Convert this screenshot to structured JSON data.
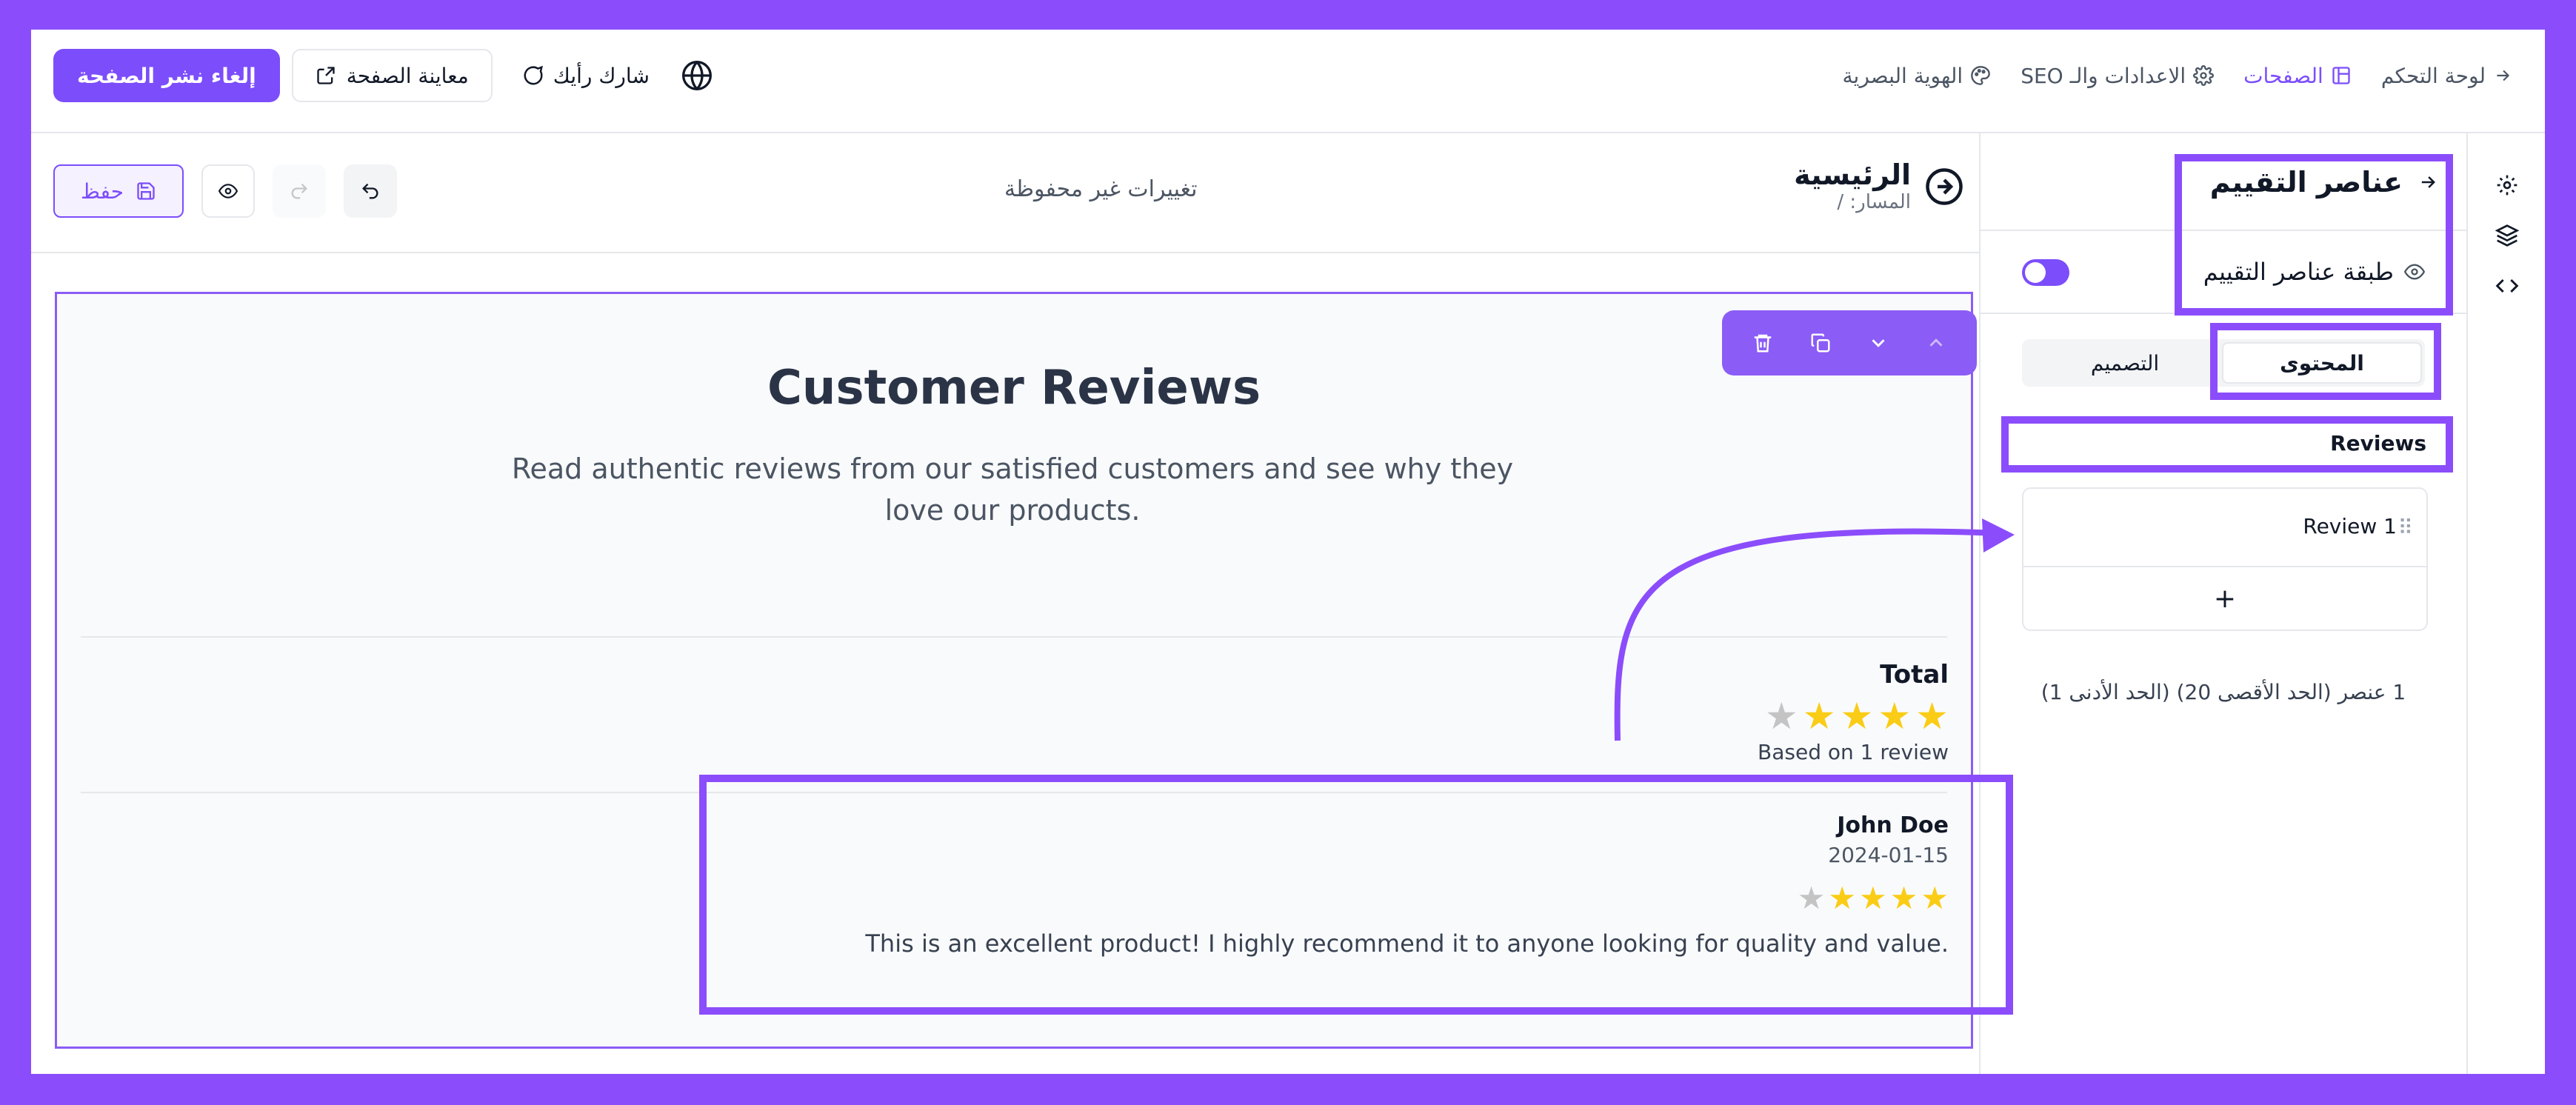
{
  "topbar": {
    "unpublish_label": "إلغاء نشر الصفحة",
    "preview_label": "معاينة الصفحة",
    "feedback_label": "شارك رأيك",
    "nav": [
      {
        "label": "لوحة التحكم"
      },
      {
        "label": "الصفحات"
      },
      {
        "label": "الاعدادات والـ SEO"
      },
      {
        "label": "الهوية البصرية"
      }
    ]
  },
  "editor": {
    "save_label": "حفظ",
    "unsaved_text": "تغييرات غير محفوظة",
    "page_title": "الرئيسية",
    "page_path": "المسار: /"
  },
  "block": {
    "title": "Customer Reviews",
    "subtitle": "Read authentic reviews from our satisfied customers and see why they love our products.",
    "total_label": "Total",
    "total_rating": 4.5,
    "total_based": "Based on 1 review",
    "review": {
      "name": "John Doe",
      "date": "2024-01-15",
      "rating": 4.5,
      "text": "This is an excellent product! I highly recommend it to anyone looking for quality and value."
    }
  },
  "panel": {
    "title": "عناصر التقييم",
    "layer_label": "طبقة عناصر التقييم",
    "layer_visible": false,
    "tab_content": "المحتوى",
    "tab_design": "التصميم",
    "section_label": "Reviews",
    "items": [
      {
        "label": "Review 1"
      }
    ],
    "add_label": "+",
    "count_text": "1 عنصر (الحد الأقصى 20) (الحد الأدنى 1)"
  },
  "colors": {
    "accent": "#7c4dfb",
    "annotation": "#8b4dfb",
    "star": "#facc15"
  }
}
